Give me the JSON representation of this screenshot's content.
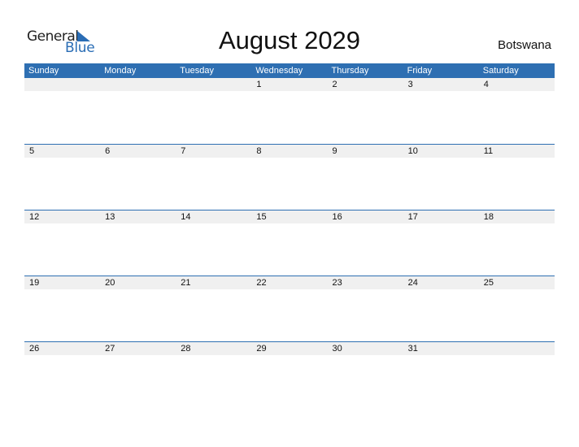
{
  "logo": {
    "general": "General",
    "blue": "Blue"
  },
  "title": "August 2029",
  "country": "Botswana",
  "colors": {
    "accent": "#2e6fb2",
    "band": "#f0f0f0"
  },
  "weekdays": [
    "Sunday",
    "Monday",
    "Tuesday",
    "Wednesday",
    "Thursday",
    "Friday",
    "Saturday"
  ],
  "weeks": [
    [
      "",
      "",
      "",
      "1",
      "2",
      "3",
      "4"
    ],
    [
      "5",
      "6",
      "7",
      "8",
      "9",
      "10",
      "11"
    ],
    [
      "12",
      "13",
      "14",
      "15",
      "16",
      "17",
      "18"
    ],
    [
      "19",
      "20",
      "21",
      "22",
      "23",
      "24",
      "25"
    ],
    [
      "26",
      "27",
      "28",
      "29",
      "30",
      "31",
      ""
    ]
  ]
}
